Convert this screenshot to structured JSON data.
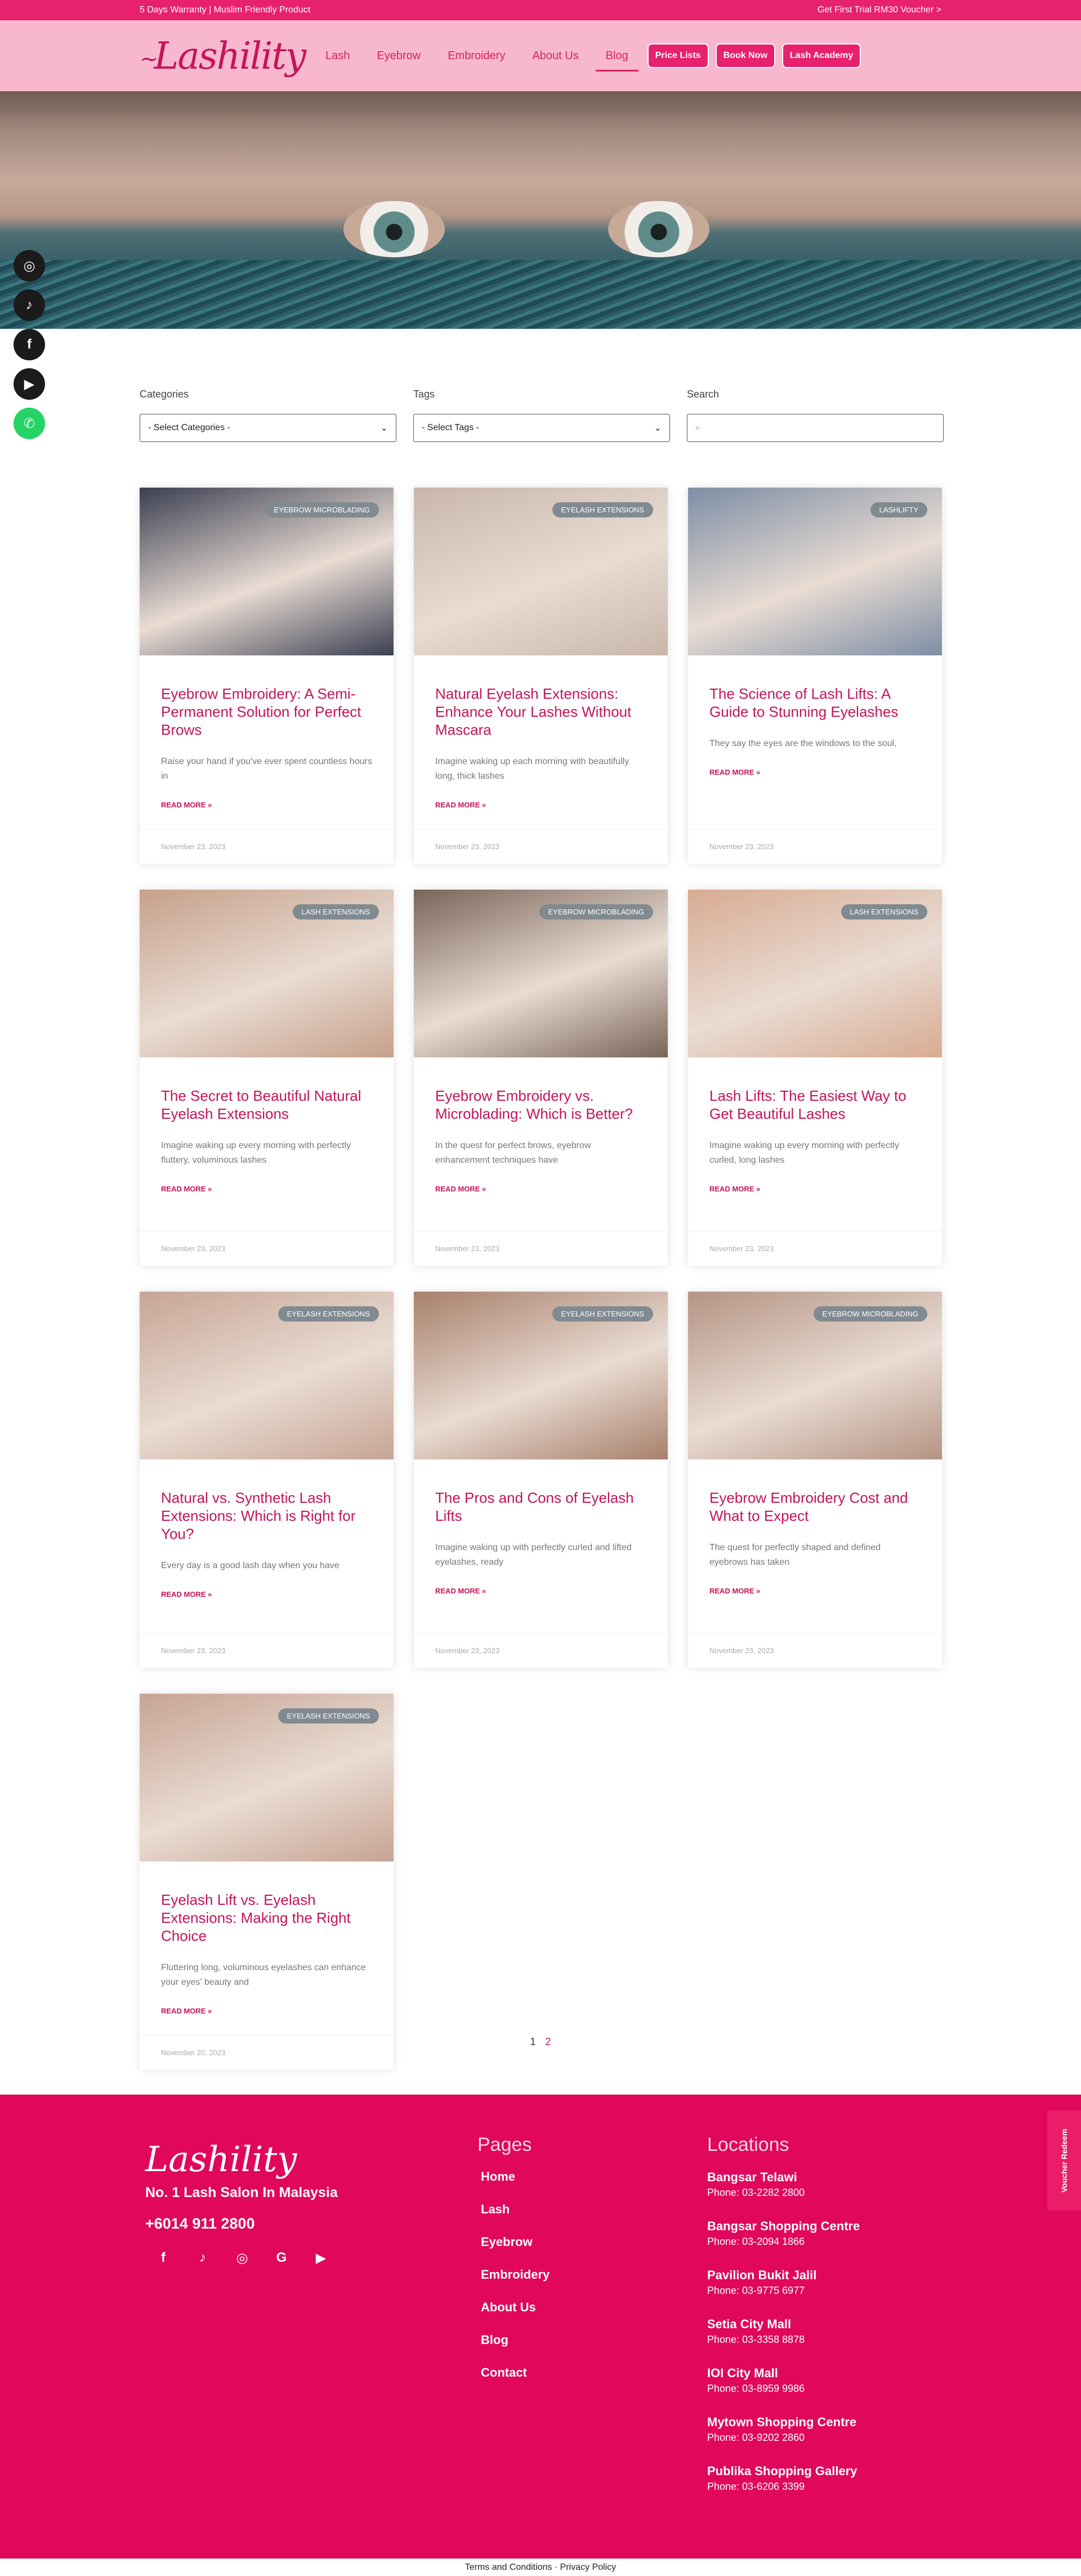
{
  "topbar": {
    "left": "5 Days Warranty | Muslim Friendly Product",
    "right": "Get First Trial RM30 Voucher >"
  },
  "header": {
    "logo": "Lashility",
    "nav": [
      {
        "label": "Lash",
        "active": false
      },
      {
        "label": "Eyebrow",
        "active": false
      },
      {
        "label": "Embroidery",
        "active": false
      },
      {
        "label": "About Us",
        "active": false
      },
      {
        "label": "Blog",
        "active": true
      }
    ],
    "buttons": [
      "Price Lists",
      "Book Now",
      "Lash Academy"
    ]
  },
  "social": [
    "instagram-icon",
    "tiktok-icon",
    "facebook-icon",
    "youtube-icon",
    "whatsapp-icon"
  ],
  "filters": {
    "categories": {
      "label": "Categories",
      "value": "- Select Categories -"
    },
    "tags": {
      "label": "Tags",
      "value": "- Select Tags -"
    },
    "search": {
      "label": "Search",
      "placeholder": ""
    }
  },
  "posts": [
    {
      "badge": "Eyebrow Microblading",
      "title": "Eyebrow Embroidery: A Semi-Permanent Solution for Perfect Brows",
      "excerpt": "Raise your hand if you've ever spent countless hours in",
      "more": "READ MORE »",
      "date": "November 23, 2023",
      "tone": "#3b3f52"
    },
    {
      "badge": "Eyelash Extensions",
      "title": "Natural Eyelash Extensions: Enhance Your Lashes Without Mascara",
      "excerpt": "Imagine waking up each morning with beautifully long, thick lashes",
      "more": "READ MORE »",
      "date": "November 23, 2023",
      "tone": "#c9b6aa"
    },
    {
      "badge": "Lashlifty",
      "title": "The Science of Lash Lifts: A Guide to Stunning Eyelashes",
      "excerpt": "They say the eyes are the windows to the soul,",
      "more": "READ MORE »",
      "date": "November 23, 2023",
      "tone": "#7d8ea5"
    },
    {
      "badge": "Lash Extensions",
      "title": "The Secret to Beautiful Natural Eyelash Extensions",
      "excerpt": "Imagine waking up every morning with perfectly fluttery, voluminous lashes",
      "more": "READ MORE »",
      "date": "November 23, 2023",
      "tone": "#c6a08a"
    },
    {
      "badge": "Eyebrow Microblading",
      "title": "Eyebrow Embroidery vs. Microblading: Which is Better?",
      "excerpt": "In the quest for perfect brows, eyebrow enhancement techniques have",
      "more": "READ MORE »",
      "date": "November 23, 2023",
      "tone": "#7a6458"
    },
    {
      "badge": "Lash Extensions",
      "title": "Lash Lifts: The Easiest Way to Get Beautiful Lashes",
      "excerpt": "Imagine waking up every morning with perfectly curled, long lashes",
      "more": "READ MORE »",
      "date": "November 23, 2023",
      "tone": "#d8ab92"
    },
    {
      "badge": "Eyelash Extensions",
      "title": "Natural vs. Synthetic Lash Extensions: Which is Right for You?",
      "excerpt": "Every day is a good lash day when you have",
      "more": "READ MORE »",
      "date": "November 23, 2023",
      "tone": "#c7a595"
    },
    {
      "badge": "Eyelash Extensions",
      "title": "The Pros and Cons of Eyelash Lifts",
      "excerpt": "Imagine waking up with perfectly curled and lifted eyelashes, ready",
      "more": "READ MORE »",
      "date": "November 23, 2023",
      "tone": "#a8806b"
    },
    {
      "badge": "Eyebrow Microblading",
      "title": "Eyebrow Embroidery Cost and What to Expect",
      "excerpt": "The quest for perfectly shaped and defined eyebrows has taken",
      "more": "READ MORE »",
      "date": "November 23, 2023",
      "tone": "#b49483"
    },
    {
      "badge": "Eyelash Extensions",
      "title": "Eyelash Lift vs. Eyelash Extensions: Making the Right Choice",
      "excerpt": "Fluttering long, voluminous eyelashes can enhance your eyes' beauty and",
      "more": "READ MORE »",
      "date": "November 20, 2023",
      "tone": "#c7a493"
    }
  ],
  "pagination": [
    "1",
    "2"
  ],
  "footer": {
    "logo": "Lashility",
    "tagline": "No. 1 Lash Salon In Malaysia",
    "phone": "+6014 911 2800",
    "icons": [
      "facebook-icon",
      "tiktok-icon",
      "instagram-icon",
      "google-icon",
      "youtube-icon"
    ],
    "pages_title": "Pages",
    "pages": [
      "Home",
      "Lash",
      "Eyebrow",
      "Embroidery",
      "About Us",
      "Blog",
      "Contact"
    ],
    "locations_title": "Locations",
    "locations": [
      {
        "name": "Bangsar Telawi",
        "phone": "Phone: 03-2282 2800"
      },
      {
        "name": "Bangsar Shopping Centre",
        "phone": "Phone: 03-2094 1866"
      },
      {
        "name": "Pavilion Bukit Jalil",
        "phone": "Phone: 03-9775 6977"
      },
      {
        "name": "Setia City Mall",
        "phone": "Phone: 03-3358 8878"
      },
      {
        "name": "IOI City Mall",
        "phone": "Phone: 03-8959 9986"
      },
      {
        "name": "Mytown Shopping Centre",
        "phone": "Phone: 03-9202 2860"
      },
      {
        "name": "Publika Shopping Gallery",
        "phone": "Phone: 03-6206 3399"
      }
    ]
  },
  "voucher": "Voucher Redeem",
  "bottom": "Terms and Conditions · Privacy Policy"
}
